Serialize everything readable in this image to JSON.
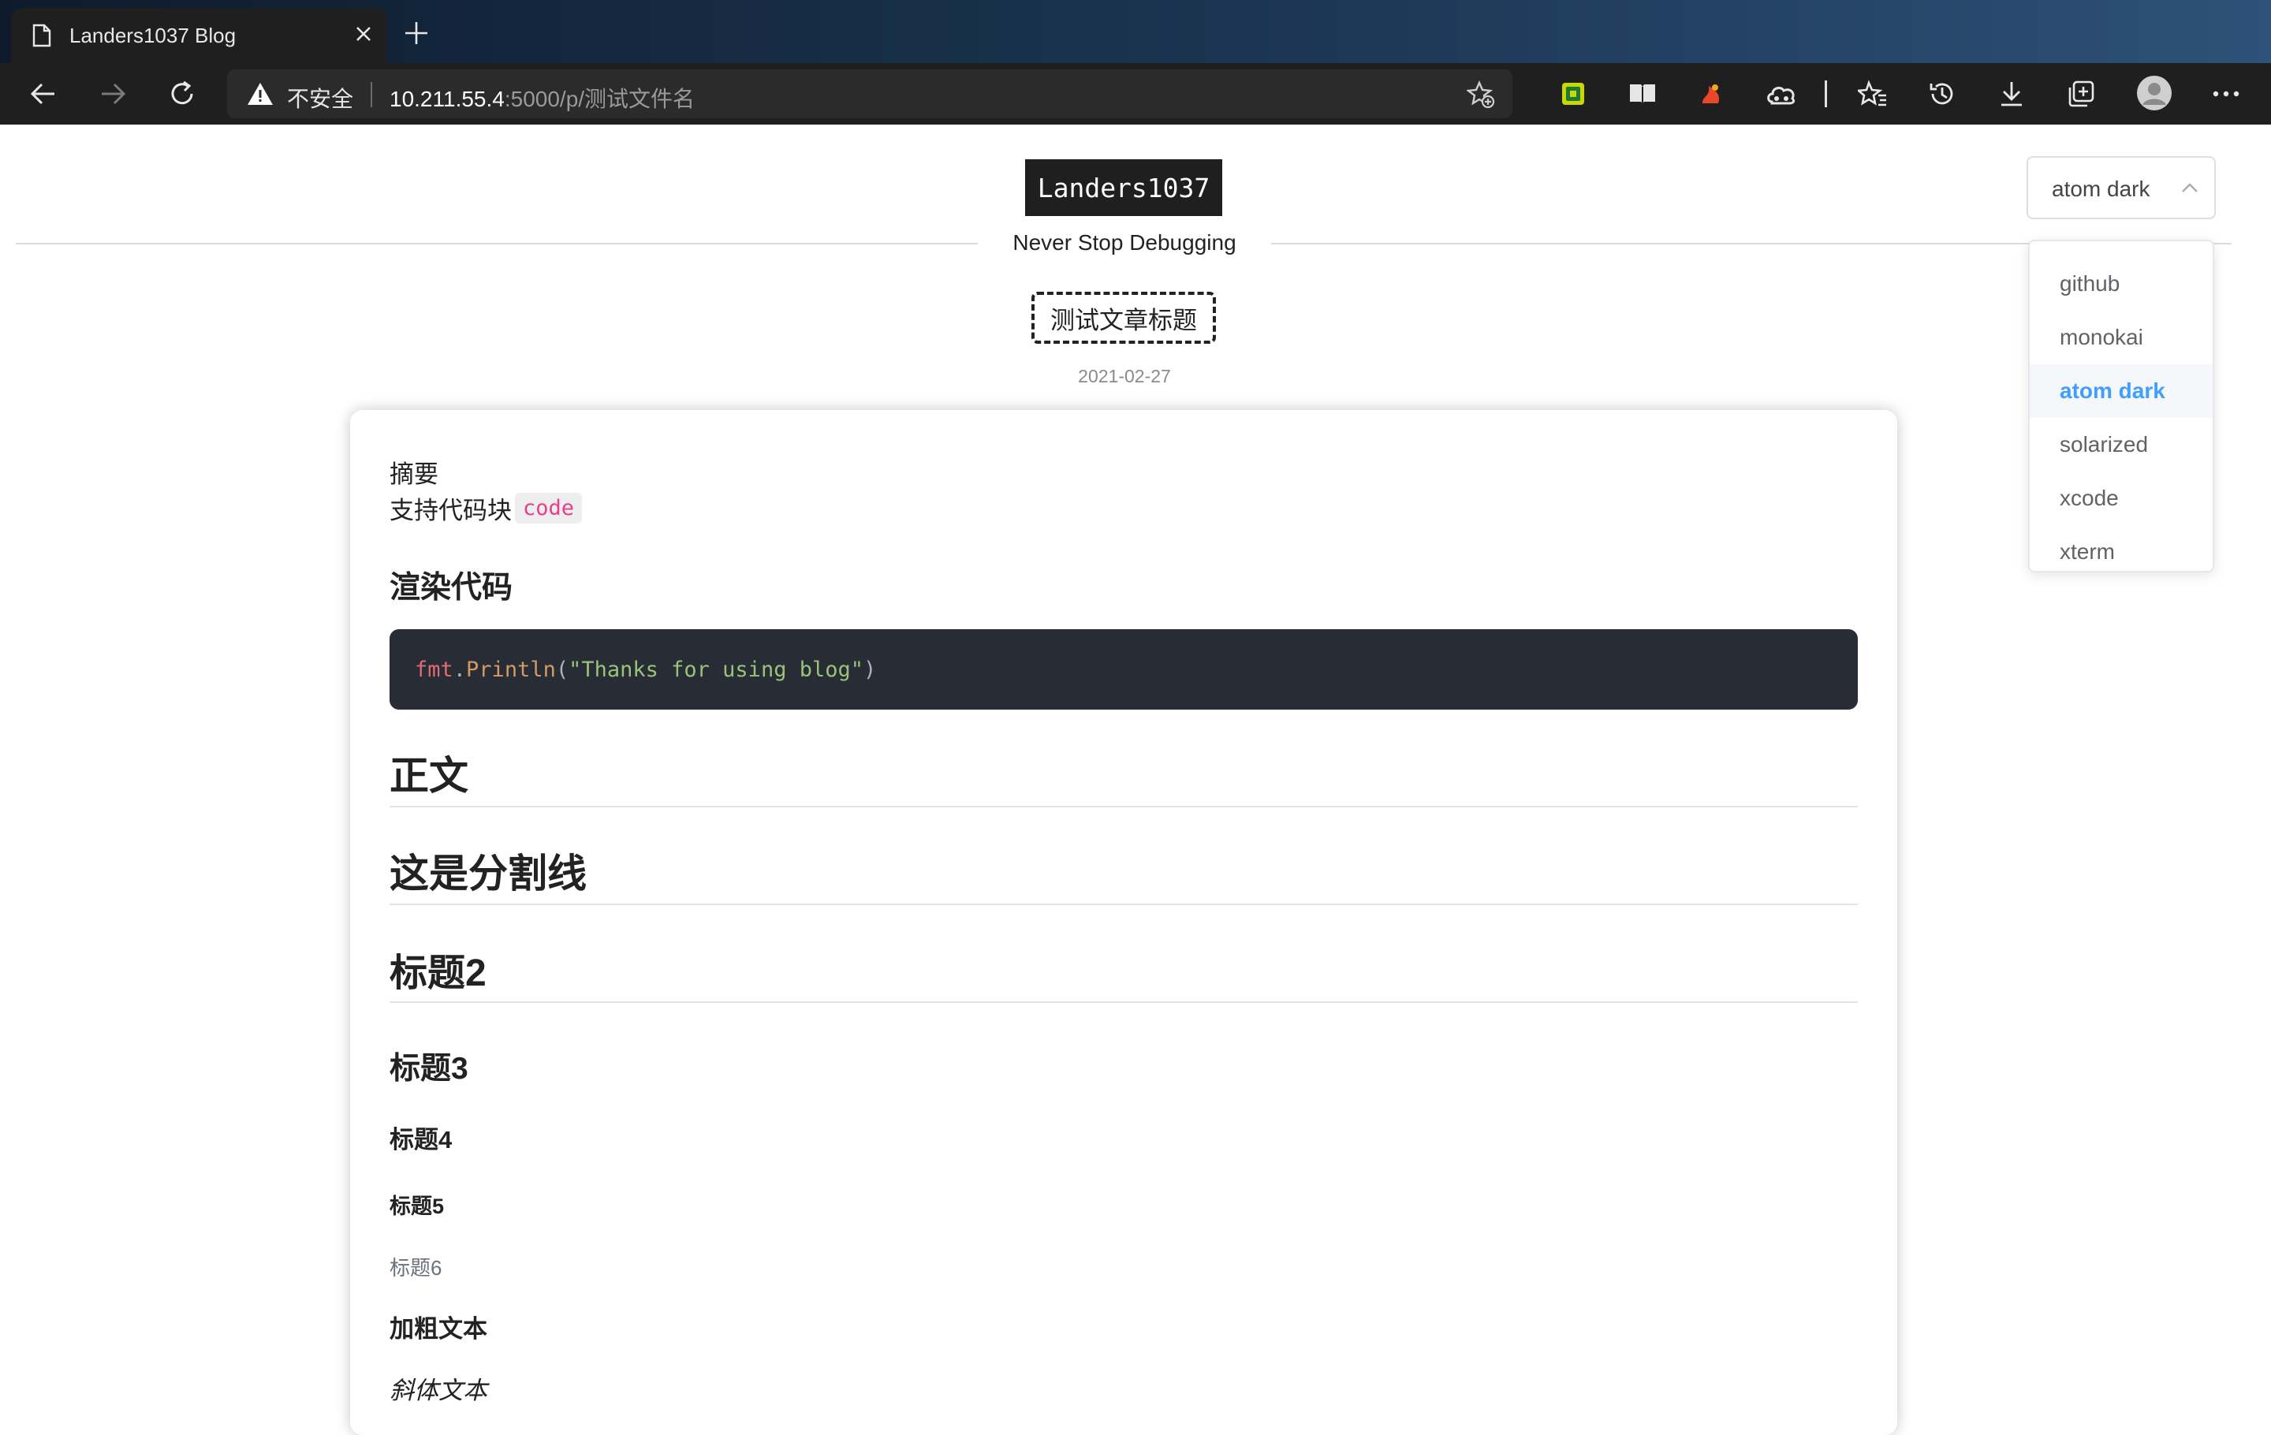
{
  "browser": {
    "tab_title": "Landers1037 Blog",
    "insecure_label": "不安全",
    "url_host": "10.211.55.4",
    "url_rest": ":5000/p/测试文件名"
  },
  "site": {
    "logo": "Landers1037",
    "tagline": "Never Stop Debugging"
  },
  "post": {
    "title": "测试文章标题",
    "date": "2021-02-27",
    "summary_label": "摘要",
    "summary_text": "支持代码块",
    "inline_code": "code",
    "render_heading": "渲染代码",
    "code": {
      "obj": "fmt",
      "dot": ".",
      "fn": "Println",
      "open": "(",
      "str": "\"Thanks for using blog\"",
      "close": ")"
    },
    "h_body": "正文",
    "h_divider": "这是分割线",
    "h2": "标题2",
    "h3": "标题3",
    "h4": "标题4",
    "h5": "标题5",
    "h6": "标题6",
    "bold_text": "加粗文本",
    "italic_text": "斜体文本"
  },
  "theme_select": {
    "value": "atom dark",
    "options": [
      "github",
      "monokai",
      "atom dark",
      "solarized",
      "xcode",
      "xterm"
    ],
    "active": "atom dark"
  },
  "colors": {
    "code_bg": "#282c34",
    "inline_code": "#e83e8c",
    "active_option": "#409eff"
  }
}
